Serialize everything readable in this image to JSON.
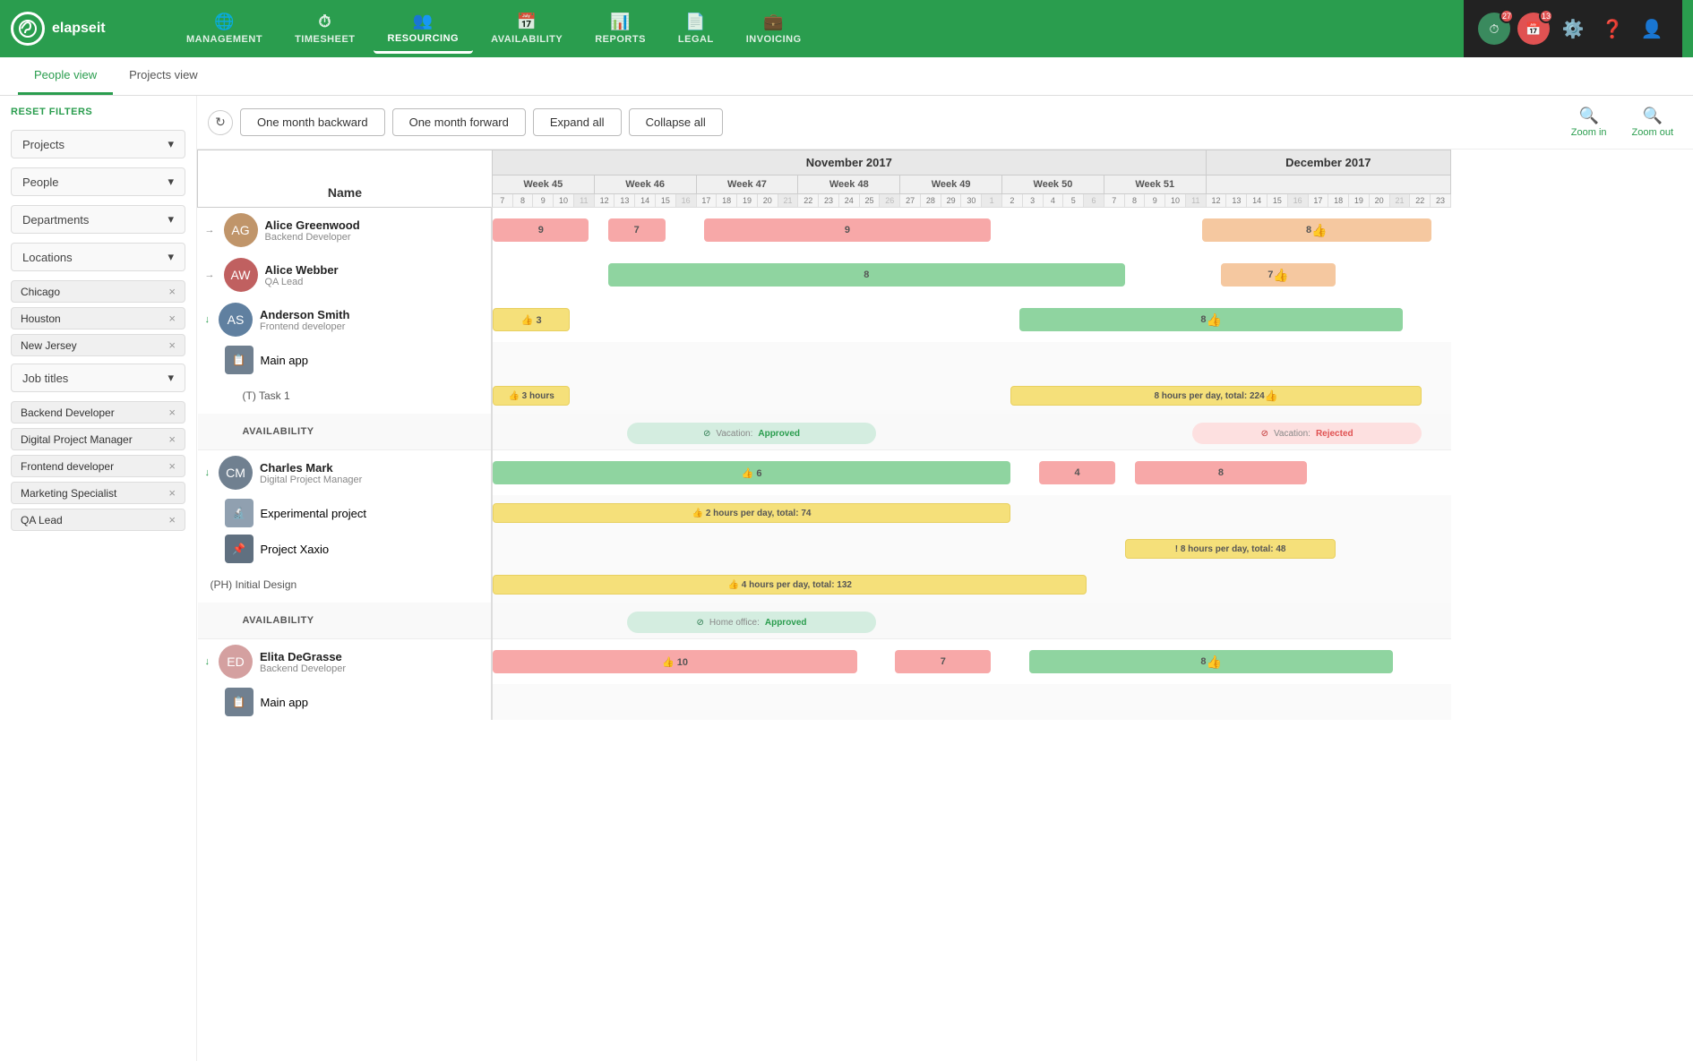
{
  "app": {
    "name": "elapseit",
    "logo_char": "e"
  },
  "nav": {
    "items": [
      {
        "id": "management",
        "label": "MANAGEMENT",
        "icon": "🌐"
      },
      {
        "id": "timesheet",
        "label": "TIMESHEET",
        "icon": "⏱"
      },
      {
        "id": "resourcing",
        "label": "RESOURCING",
        "icon": "👥",
        "active": true
      },
      {
        "id": "availability",
        "label": "AVAILABILITY",
        "icon": "📅"
      },
      {
        "id": "reports",
        "label": "REPORTS",
        "icon": "📊"
      },
      {
        "id": "legal",
        "label": "LEGAL",
        "icon": "📄"
      },
      {
        "id": "invoicing",
        "label": "INVOICING",
        "icon": "💼"
      }
    ],
    "badges": [
      {
        "icon": "🕐",
        "count": "27",
        "color": "#e05252"
      },
      {
        "icon": "📅",
        "count": "13",
        "color": "#e05252"
      }
    ]
  },
  "sub_nav": {
    "items": [
      {
        "label": "People view",
        "active": true
      },
      {
        "label": "Projects view",
        "active": false
      }
    ]
  },
  "toolbar": {
    "one_month_backward": "One month backward",
    "one_month_forward": "One month forward",
    "expand_all": "Expand all",
    "collapse_all": "Collapse all",
    "zoom_in": "Zoom in",
    "zoom_out": "Zoom out"
  },
  "sidebar": {
    "reset_filters": "RESET FILTERS",
    "filters": [
      {
        "label": "Projects",
        "type": "dropdown"
      },
      {
        "label": "People",
        "type": "dropdown"
      },
      {
        "label": "Departments",
        "type": "dropdown"
      },
      {
        "label": "Locations",
        "type": "dropdown-section",
        "tags": [
          "Chicago",
          "Houston",
          "New Jersey"
        ]
      },
      {
        "label": "Job titles",
        "type": "dropdown-section",
        "tags": [
          "Backend Developer",
          "Digital Project Manager",
          "Frontend developer",
          "Marketing Specialist",
          "QA Lead"
        ]
      }
    ]
  },
  "gantt": {
    "name_col_label": "Name",
    "months": [
      {
        "label": "November 2017",
        "span": 35
      },
      {
        "label": "December 2017",
        "span": 28
      }
    ],
    "weeks": [
      {
        "label": "Week 45",
        "span": 5
      },
      {
        "label": "Week 46",
        "span": 5
      },
      {
        "label": "Week 47",
        "span": 5
      },
      {
        "label": "Week 48",
        "span": 5
      },
      {
        "label": "Week 49",
        "span": 5
      },
      {
        "label": "Week 50",
        "span": 5
      },
      {
        "label": "Week 51",
        "span": 5
      }
    ],
    "days_nov": [
      "7",
      "8",
      "9",
      "10",
      "11",
      "12",
      "13",
      "14",
      "15",
      "16",
      "17",
      "18",
      "19",
      "20",
      "21",
      "22",
      "23",
      "24",
      "25",
      "26",
      "27",
      "28",
      "29",
      "30"
    ],
    "days_dec": [
      "1",
      "2",
      "3",
      "4",
      "5",
      "6",
      "7",
      "8",
      "9",
      "10",
      "11",
      "12",
      "13",
      "14",
      "15",
      "16",
      "17",
      "18",
      "19",
      "20",
      "21",
      "22",
      "23"
    ],
    "people": [
      {
        "name": "Alice Greenwood",
        "role": "Backend Developer",
        "avatar_color": "#c0a080",
        "expanded": false,
        "bars": [
          {
            "start_pct": 0,
            "width_pct": 12,
            "value": "9",
            "type": "pink"
          },
          {
            "start_pct": 14,
            "width_pct": 6,
            "value": "7",
            "type": "pink"
          },
          {
            "start_pct": 22,
            "width_pct": 30,
            "value": "9",
            "type": "pink"
          },
          {
            "start_pct": 73,
            "width_pct": 22,
            "value": "8",
            "type": "peach"
          }
        ]
      },
      {
        "name": "Alice Webber",
        "role": "QA Lead",
        "avatar_color": "#c06060",
        "expanded": false,
        "bars": [
          {
            "start_pct": 14,
            "width_pct": 54,
            "value": "8",
            "type": "green"
          },
          {
            "start_pct": 74,
            "width_pct": 10,
            "value": "7",
            "type": "peach"
          }
        ]
      },
      {
        "name": "Anderson Smith",
        "role": "Frontend developer",
        "avatar_color": "#6080a0",
        "expanded": true,
        "bars": [
          {
            "start_pct": 0,
            "width_pct": 10,
            "value": "👍 3",
            "type": "yellow"
          },
          {
            "start_pct": 55,
            "width_pct": 40,
            "value": "8",
            "type": "green"
          }
        ],
        "sub_items": [
          {
            "name": "Main app",
            "type": "project",
            "tasks": [
              {
                "label": "(T) Task 1",
                "bars": [
                  {
                    "start_pct": 0,
                    "width_pct": 10,
                    "value": "👍 3 hours",
                    "type": "yellow"
                  },
                  {
                    "start_pct": 52,
                    "width_pct": 43,
                    "value": "8 hours per day, total: 224",
                    "type": "yellow"
                  }
                ]
              }
            ]
          }
        ],
        "availability": {
          "items": [
            {
              "start_pct": 14,
              "width_pct": 28,
              "label": "Vacation:",
              "status": "Approved",
              "type": "approved"
            },
            {
              "start_pct": 73,
              "width_pct": 22,
              "label": "Vacation:",
              "status": "Rejected",
              "type": "rejected"
            }
          ]
        }
      },
      {
        "name": "Charles Mark",
        "role": "Digital Project Manager",
        "avatar_color": "#708090",
        "expanded": true,
        "bars": [
          {
            "start_pct": 0,
            "width_pct": 55,
            "value": "👍 6",
            "type": "green"
          },
          {
            "start_pct": 57,
            "width_pct": 9,
            "value": "4",
            "type": "pink"
          },
          {
            "start_pct": 68,
            "width_pct": 18,
            "value": "8",
            "type": "pink"
          }
        ],
        "sub_items": [
          {
            "name": "Experimental project",
            "type": "project",
            "tasks": [
              {
                "label": "",
                "bars": [
                  {
                    "start_pct": 0,
                    "width_pct": 55,
                    "value": "👍 2 hours per day, total: 74",
                    "type": "yellow"
                  }
                ]
              }
            ]
          },
          {
            "name": "Project Xaxio",
            "type": "project",
            "tasks": [
              {
                "label": "",
                "bars": [
                  {
                    "start_pct": 66,
                    "width_pct": 20,
                    "value": "! 8 hours per day, total: 48",
                    "type": "yellow"
                  }
                ]
              }
            ]
          },
          {
            "name": "(PH) Initial Design",
            "type": "task",
            "tasks": [
              {
                "label": "",
                "bars": [
                  {
                    "start_pct": 0,
                    "width_pct": 62,
                    "value": "👍 4 hours per day, total: 132",
                    "type": "yellow"
                  }
                ]
              }
            ]
          }
        ],
        "availability": {
          "items": [
            {
              "start_pct": 14,
              "width_pct": 28,
              "label": "Home office:",
              "status": "Approved",
              "type": "approved"
            }
          ]
        }
      },
      {
        "name": "Elita DeGrasse",
        "role": "Backend Developer",
        "avatar_color": "#d4a0a0",
        "expanded": true,
        "bars": [
          {
            "start_pct": 0,
            "width_pct": 40,
            "value": "👍 10",
            "type": "pink"
          },
          {
            "start_pct": 44,
            "width_pct": 12,
            "value": "7",
            "type": "pink"
          },
          {
            "start_pct": 60,
            "width_pct": 35,
            "value": "8",
            "type": "green"
          }
        ],
        "sub_items": [
          {
            "name": "Main app",
            "type": "project",
            "tasks": []
          }
        ]
      }
    ]
  }
}
